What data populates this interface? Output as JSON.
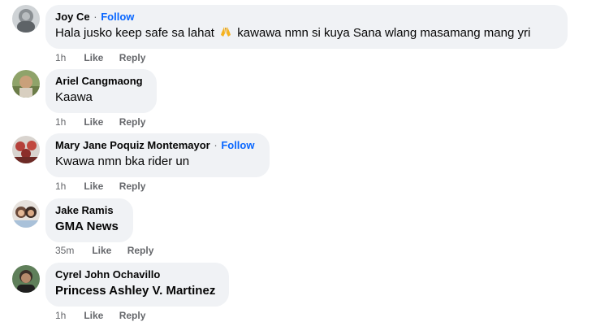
{
  "comments": [
    {
      "author": "Joy Ce",
      "dot": "·",
      "follow": "Follow",
      "text_before": "Hala jusko keep safe sa lahat",
      "emoji": "folded-hands-icon",
      "text_after": "kawawa nmn si kuya Sana wlang masamang mang yri",
      "time": "1h",
      "like": "Like",
      "reply": "Reply"
    },
    {
      "author": "Ariel Cangmaong",
      "text": "Kaawa",
      "time": "1h",
      "like": "Like",
      "reply": "Reply"
    },
    {
      "author": "Mary Jane Poquiz Montemayor",
      "dot": "·",
      "follow": "Follow",
      "text": "Kwawa nmn bka rider un",
      "time": "1h",
      "like": "Like",
      "reply": "Reply"
    },
    {
      "author": "Jake Ramis",
      "text": "GMA News",
      "time": "35m",
      "like": "Like",
      "reply": "Reply"
    },
    {
      "author": "Cyrel John Ochavillo",
      "text": "Princess Ashley V. Martinez",
      "time": "1h",
      "like": "Like",
      "reply": "Reply"
    }
  ],
  "colors": {
    "bubble": "#f0f2f5",
    "follow": "#0866ff",
    "meta": "#65676b"
  }
}
